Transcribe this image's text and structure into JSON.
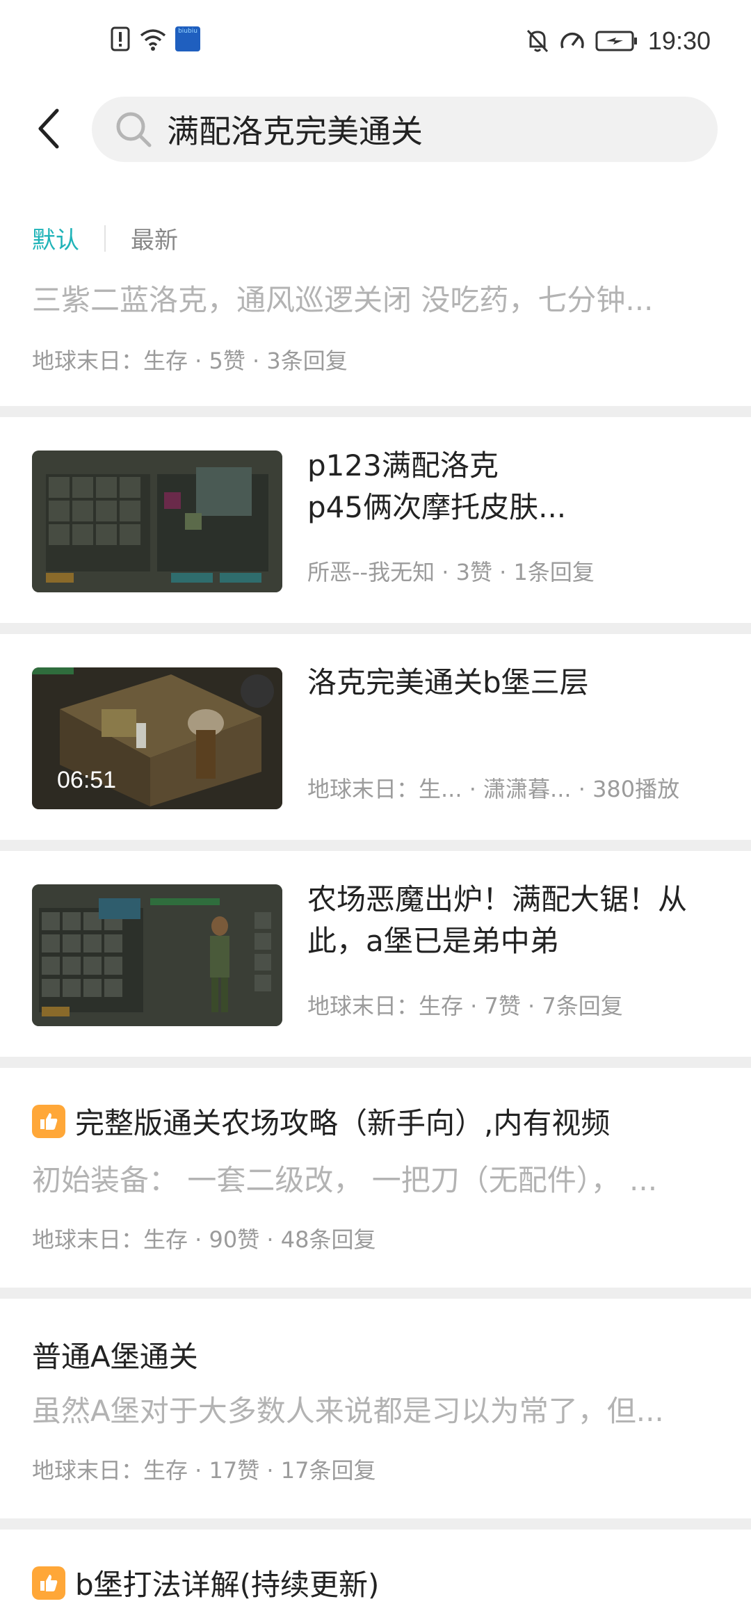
{
  "status_bar": {
    "time": "19:30",
    "app_badge_text": "biubiu"
  },
  "header": {
    "search_value": "满配洛克完美通关"
  },
  "sort_tabs": [
    {
      "label": "默认",
      "active": true
    },
    {
      "label": "最新",
      "active": false
    }
  ],
  "first_result": {
    "snippet": "三紫二蓝洛克，通风巡逻关闭 没吃药，七分钟...",
    "meta": "地球末日：生存 · 5赞 · 3条回复"
  },
  "media_results": [
    {
      "title": "p123满配洛克\np45俩次摩托皮肤...",
      "meta": "所恶--我无知 · 3赞 · 1条回复"
    },
    {
      "title": "洛克完美通关b堡三层",
      "duration": "06:51",
      "meta": "地球末日：生... · 潇潇暮... · 380播放"
    },
    {
      "title": "农场恶魔出炉！满配大锯！从此，a堡已是弟中弟",
      "meta": "地球末日：生存 · 7赞 · 7条回复"
    }
  ],
  "text_results": [
    {
      "title": "完整版通关农场攻略（新手向）,内有视频",
      "has_like_badge": true,
      "snippet": "初始装备： 一套二级改， 一把刀（无配件）， ...",
      "meta": "地球末日：生存 · 90赞 · 48条回复"
    },
    {
      "title": "普通A堡通关",
      "has_like_badge": false,
      "snippet": "虽然A堡对于大多数人来说都是习以为常了，但...",
      "meta": "地球末日：生存 · 17赞 · 17条回复"
    },
    {
      "title": "b堡打法详解(持续更新)",
      "has_like_badge": true
    }
  ],
  "colors": {
    "accent": "#1fb3b8",
    "like_badge": "#ffa738",
    "separator": "#eeeeee"
  }
}
